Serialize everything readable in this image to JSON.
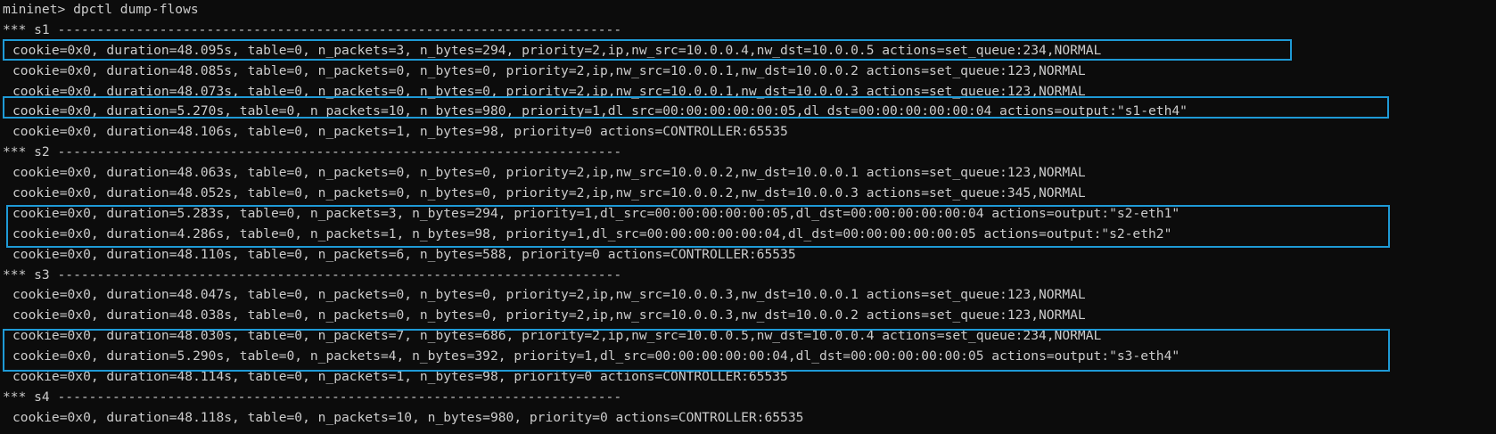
{
  "prompt_line": "mininet> dpctl dump-flows",
  "switches": [
    {
      "header": "*** s1 ------------------------------------------------------------------------",
      "flows": [
        "cookie=0x0, duration=48.095s, table=0, n_packets=3, n_bytes=294, priority=2,ip,nw_src=10.0.0.4,nw_dst=10.0.0.5 actions=set_queue:234,NORMAL",
        "cookie=0x0, duration=48.085s, table=0, n_packets=0, n_bytes=0, priority=2,ip,nw_src=10.0.0.1,nw_dst=10.0.0.2 actions=set_queue:123,NORMAL",
        "cookie=0x0, duration=48.073s, table=0, n_packets=0, n_bytes=0, priority=2,ip,nw_src=10.0.0.1,nw_dst=10.0.0.3 actions=set_queue:123,NORMAL",
        "cookie=0x0, duration=5.270s, table=0, n_packets=10, n_bytes=980, priority=1,dl_src=00:00:00:00:00:05,dl_dst=00:00:00:00:00:04 actions=output:\"s1-eth4\"",
        "cookie=0x0, duration=48.106s, table=0, n_packets=1, n_bytes=98, priority=0 actions=CONTROLLER:65535"
      ]
    },
    {
      "header": "*** s2 ------------------------------------------------------------------------",
      "flows": [
        "cookie=0x0, duration=48.063s, table=0, n_packets=0, n_bytes=0, priority=2,ip,nw_src=10.0.0.2,nw_dst=10.0.0.1 actions=set_queue:123,NORMAL",
        "cookie=0x0, duration=48.052s, table=0, n_packets=0, n_bytes=0, priority=2,ip,nw_src=10.0.0.2,nw_dst=10.0.0.3 actions=set_queue:345,NORMAL",
        "cookie=0x0, duration=5.283s, table=0, n_packets=3, n_bytes=294, priority=1,dl_src=00:00:00:00:00:05,dl_dst=00:00:00:00:00:04 actions=output:\"s2-eth1\"",
        "cookie=0x0, duration=4.286s, table=0, n_packets=1, n_bytes=98, priority=1,dl_src=00:00:00:00:00:04,dl_dst=00:00:00:00:00:05 actions=output:\"s2-eth2\"",
        "cookie=0x0, duration=48.110s, table=0, n_packets=6, n_bytes=588, priority=0 actions=CONTROLLER:65535"
      ]
    },
    {
      "header": "*** s3 ------------------------------------------------------------------------",
      "flows": [
        "cookie=0x0, duration=48.047s, table=0, n_packets=0, n_bytes=0, priority=2,ip,nw_src=10.0.0.3,nw_dst=10.0.0.1 actions=set_queue:123,NORMAL",
        "cookie=0x0, duration=48.038s, table=0, n_packets=0, n_bytes=0, priority=2,ip,nw_src=10.0.0.3,nw_dst=10.0.0.2 actions=set_queue:123,NORMAL",
        "cookie=0x0, duration=48.030s, table=0, n_packets=7, n_bytes=686, priority=2,ip,nw_src=10.0.0.5,nw_dst=10.0.0.4 actions=set_queue:234,NORMAL",
        "cookie=0x0, duration=5.290s, table=0, n_packets=4, n_bytes=392, priority=1,dl_src=00:00:00:00:00:04,dl_dst=00:00:00:00:00:05 actions=output:\"s3-eth4\"",
        "cookie=0x0, duration=48.114s, table=0, n_packets=1, n_bytes=98, priority=0 actions=CONTROLLER:65535"
      ]
    },
    {
      "header": "*** s4 ------------------------------------------------------------------------",
      "flows": [
        "cookie=0x0, duration=48.118s, table=0, n_packets=10, n_bytes=980, priority=0 actions=CONTROLLER:65535"
      ]
    }
  ],
  "colors": {
    "background": "#0c0c0c",
    "text": "#cccccc",
    "highlight_border": "#1e9ad6"
  }
}
